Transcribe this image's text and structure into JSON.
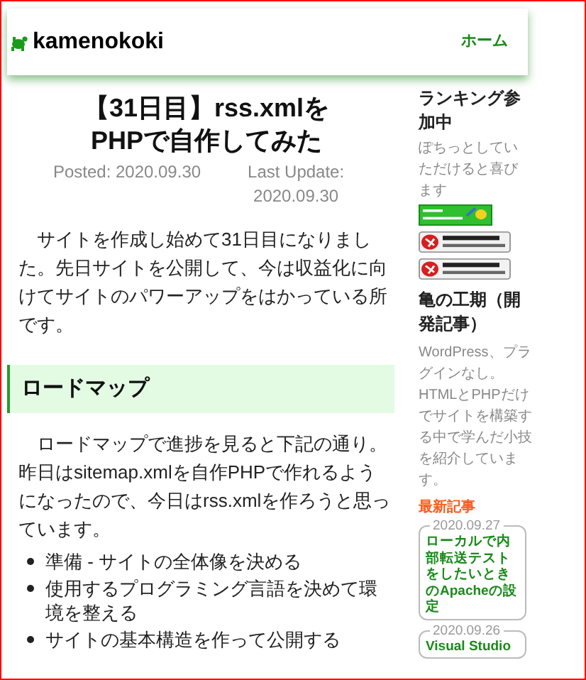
{
  "header": {
    "site_title": "kamenokoki",
    "nav": [
      {
        "label": "ホーム"
      }
    ]
  },
  "article": {
    "title": "【31日目】rss.xmlをPHPで自作してみた",
    "posted": "Posted: 2020.09.30",
    "updated": "Last Update: 2020.09.30",
    "intro": "サイトを作成し始めて31日目になりました。先日サイトを公開して、今は収益化に向けてサイトのパワーアップをはかっている所です。",
    "section_heading": "ロードマップ",
    "section_text": "ロードマップで進捗を見ると下記の通り。昨日はsitemap.xmlを自作PHPで作れるようになったので、今日はrss.xmlを作ろうと思っています。",
    "bullets": [
      "準備 - サイトの全体像を決める",
      "使用するプログラミング言語を決めて環境を整える",
      "サイトの基本構造を作って公開する"
    ]
  },
  "sidebar": {
    "ranking_heading": "ランキング参加中",
    "ranking_text": "ぽちっとしていただけると喜びます",
    "banners": [
      {
        "kind": "fc2"
      },
      {
        "kind": "ranking"
      },
      {
        "kind": "ranking"
      }
    ],
    "about_heading": "亀の工期（開発記事）",
    "about_text": "WordPress、プラグインなし。HTMLとPHPだけでサイトを構築する中で学んだ小技を紹介しています。",
    "recent_heading": "最新記事",
    "recent_posts": [
      {
        "date": "2020.09.27",
        "title": "ローカルで内部転送テストをしたいときのApacheの設定"
      },
      {
        "date": "2020.09.26",
        "title": "Visual Studio"
      }
    ]
  }
}
